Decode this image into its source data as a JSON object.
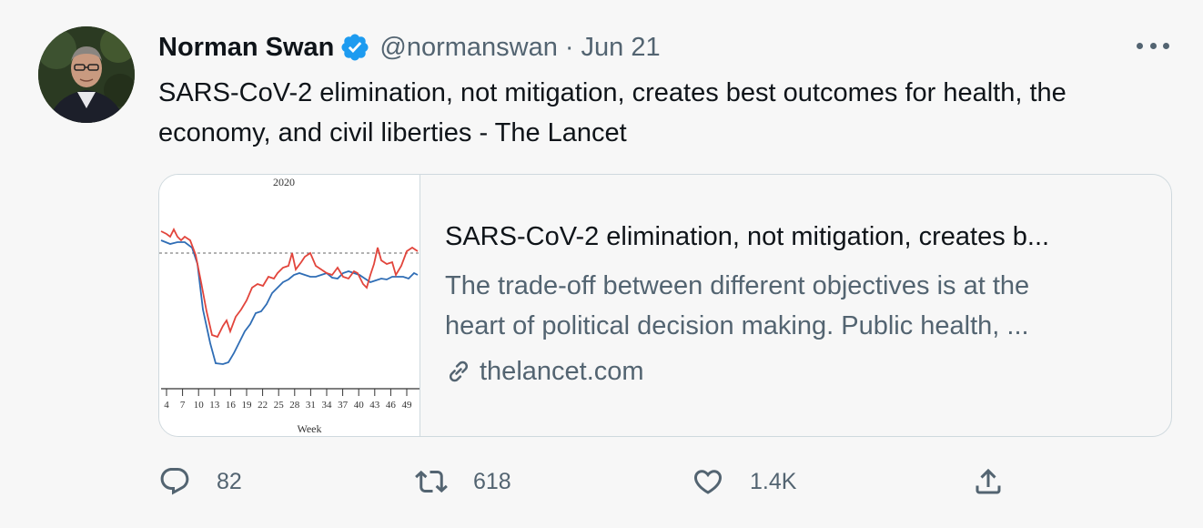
{
  "tweet": {
    "author_name": "Norman Swan",
    "handle": "@normanswan",
    "separator": "·",
    "date": "Jun 21",
    "text": "SARS-CoV-2 elimination, not mitigation, creates best outcomes for health, the economy, and civil liberties - The Lancet",
    "verified": true
  },
  "card": {
    "title": "SARS-CoV-2 elimination, not mitigation, creates b...",
    "description_line1": "The trade-off between different objectives is at the",
    "description_line2": "heart of political decision making. Public health, ...",
    "domain": "thelancet.com"
  },
  "thumbnail_chart": {
    "year_label": "2020",
    "xlabel": "Week",
    "tick_labels": [
      "4",
      "7",
      "10",
      "13",
      "16",
      "19",
      "22",
      "25",
      "28",
      "31",
      "34",
      "37",
      "40",
      "43",
      "46",
      "49"
    ]
  },
  "actions": {
    "reply_count": "82",
    "retweet_count": "618",
    "like_count": "1.4K"
  },
  "colors": {
    "text_primary": "#0f1419",
    "text_secondary": "#536471",
    "verified_blue": "#1d9bf0",
    "border": "#cfd9de",
    "chart_red": "#e2453c",
    "chart_blue": "#2f6db5"
  },
  "icons": [
    "verified-badge-icon",
    "more-icon",
    "link-icon",
    "reply-icon",
    "retweet-icon",
    "like-icon",
    "share-icon"
  ]
}
